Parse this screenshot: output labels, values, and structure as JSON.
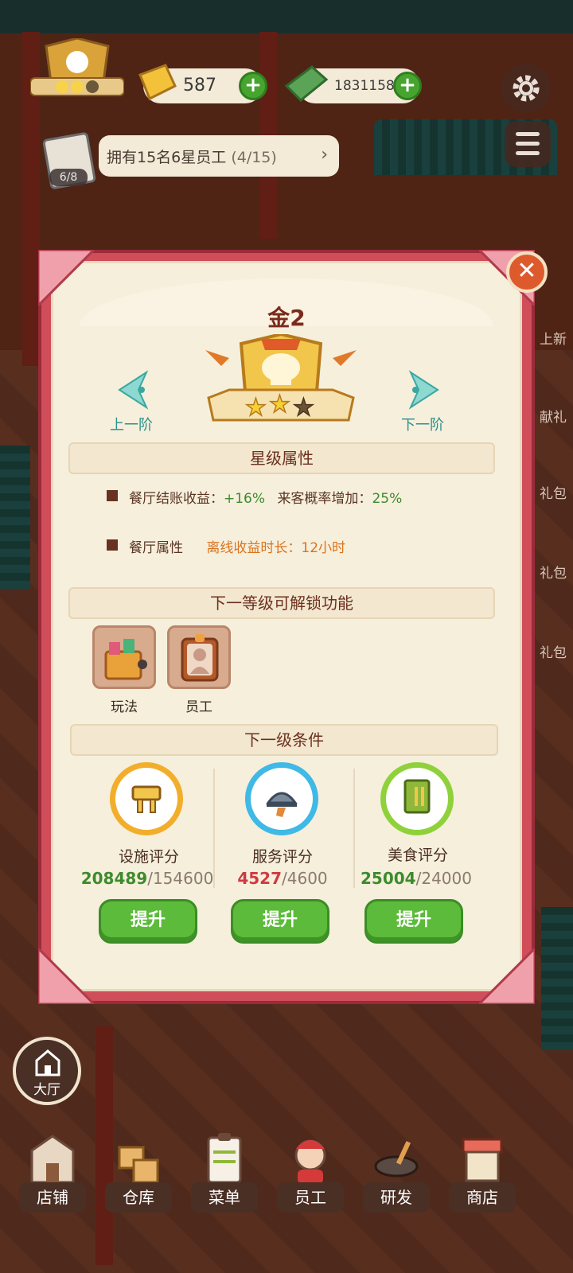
{
  "hud": {
    "gold": "587",
    "cash": "18311580",
    "plus_label": "+",
    "book_count": "6/8",
    "staff_notice": "拥有15名6星员工",
    "staff_progress": "(4/15)"
  },
  "side_labels": [
    "上新",
    "献礼",
    "礼包",
    "礼包",
    "礼包"
  ],
  "dialog": {
    "close_label": "✕",
    "rank_title": "金2",
    "prev_label": "上一阶",
    "next_label": "下一阶",
    "stars_filled": 2,
    "stars_total": 3,
    "sections": {
      "star_attr": "星级属性",
      "unlock": "下一等级可解锁功能",
      "condition": "下一级条件"
    },
    "attr1": {
      "label": "餐厅结账收益：",
      "value": "+16%",
      "label2": "来客概率增加：",
      "value2": "25%"
    },
    "attr2": {
      "label": "餐厅属性",
      "value_label": "离线收益时长：",
      "value": "12小时"
    },
    "unlocks": [
      {
        "label": "玩法",
        "icon": "gift-box-icon"
      },
      {
        "label": "员工",
        "icon": "staff-card-icon"
      }
    ],
    "scores": [
      {
        "label": "设施评分",
        "current": "208489",
        "target": "/154600",
        "met": true,
        "button": "提升",
        "color": "#f2ae2b"
      },
      {
        "label": "服务评分",
        "current": "4527",
        "target": "/4600",
        "met": false,
        "button": "提升",
        "color": "#3fb9e6"
      },
      {
        "label": "美食评分",
        "current": "25004",
        "target": "/24000",
        "met": true,
        "button": "提升",
        "color": "#8fd13a"
      }
    ]
  },
  "bottom_nav": {
    "hall": "大厅",
    "items": [
      "店铺",
      "仓库",
      "菜单",
      "员工",
      "研发",
      "商店"
    ]
  }
}
